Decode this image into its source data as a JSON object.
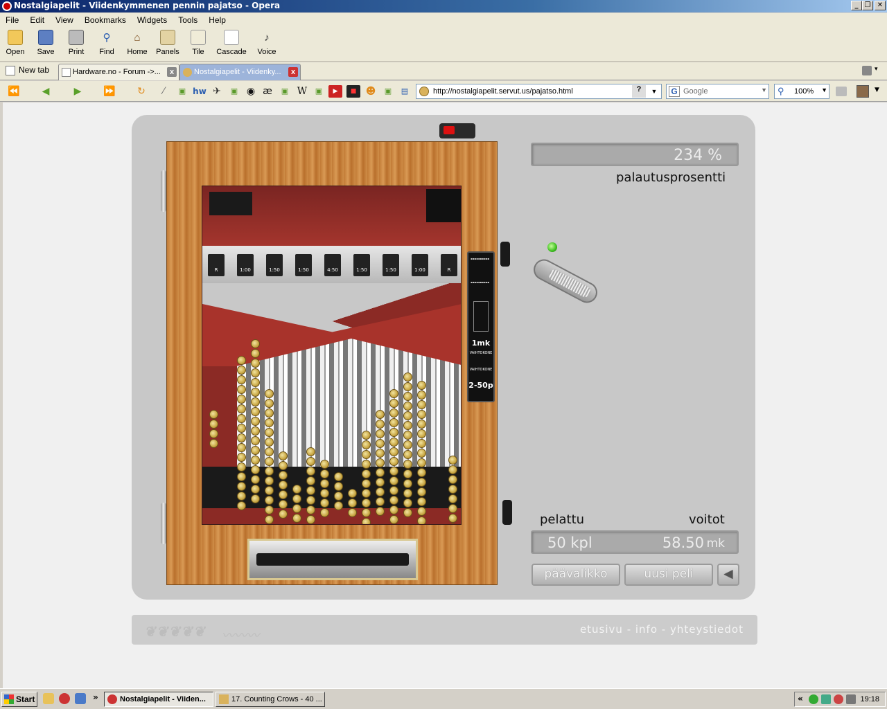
{
  "window": {
    "title": "Nostalgiapelit - Viidenkymmenen pennin pajatso - Opera",
    "minimize": "_",
    "maximize": "❐",
    "close": "✕"
  },
  "menu": [
    "File",
    "Edit",
    "View",
    "Bookmarks",
    "Widgets",
    "Tools",
    "Help"
  ],
  "toolbar": [
    {
      "label": "Open",
      "icon": "folder-icon"
    },
    {
      "label": "Save",
      "icon": "save-icon"
    },
    {
      "label": "Print",
      "icon": "print-icon"
    },
    {
      "label": "Find",
      "icon": "find-icon"
    },
    {
      "label": "Home",
      "icon": "home-icon"
    },
    {
      "label": "Panels",
      "icon": "panels-icon"
    },
    {
      "label": "Tile",
      "icon": "tile-icon"
    },
    {
      "label": "Cascade",
      "icon": "cascade-icon"
    },
    {
      "label": "Voice",
      "icon": "voice-icon"
    }
  ],
  "tabs": {
    "new_tab": "New tab",
    "items": [
      {
        "label": "Hardware.no - Forum ->...",
        "active": false
      },
      {
        "label": "Nostalgiapelit - Viidenky...",
        "active": true
      }
    ]
  },
  "address": {
    "url": "http://nostalgiapelit.servut.us/pajatso.html",
    "help": "?",
    "search_placeholder": "Google",
    "zoom": "100%"
  },
  "game": {
    "percentage": "234 %",
    "percentage_label": "palautusprosentti",
    "played_label": "pelattu",
    "won_label": "voitot",
    "played_value": "50 kpl",
    "won_value": "58.50",
    "won_unit": "mk",
    "main_menu_button": "päävalikko",
    "new_game_button": "uusi peli",
    "sound_icon": "speaker-icon",
    "cups": [
      "R",
      "1:00",
      "1:50",
      "1:50",
      "4:50",
      "1:50",
      "1:50",
      "1:00",
      "R"
    ],
    "coin_panel_top": "1mk",
    "coin_panel_bottom": "2-50p",
    "coin_panel_mid1": "VAIHTOKONE",
    "coin_panel_mid2": "VAIHTOKONE"
  },
  "footer": {
    "links": "etusivu  -  info  -  yhteystiedot"
  },
  "taskbar": {
    "start": "Start",
    "tasks": [
      {
        "label": "Nostalgiapelit - Viiden...",
        "active": true
      },
      {
        "label": "17. Counting Crows - 40 ...",
        "active": false
      }
    ],
    "clock": "19:18"
  },
  "colors": {
    "accent": "#0a246a",
    "cabinet_wood": "#c17a35",
    "playfield_red": "#8b2a25",
    "led_green": "#3cbe1e"
  }
}
